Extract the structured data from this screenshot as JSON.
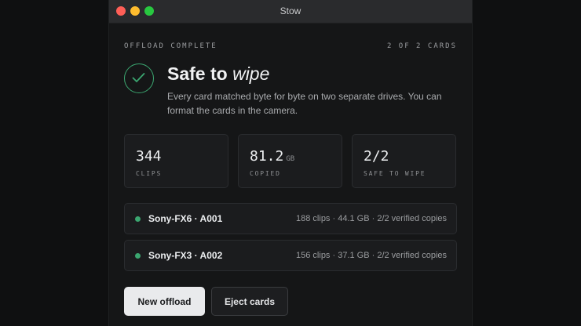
{
  "window": {
    "title": "Stow"
  },
  "header": {
    "eyebrow": "OFFLOAD COMPLETE",
    "progress": "2 OF 2 CARDS",
    "title_main": "Safe to",
    "title_emphasis": "wipe",
    "description": "Every card matched byte for byte on two separate drives. You can format the cards in the camera.",
    "status_icon": "check-icon"
  },
  "stats": [
    {
      "value": "344",
      "unit": "",
      "label": "CLIPS"
    },
    {
      "value": "81.2",
      "unit": "GB",
      "label": "COPIED"
    },
    {
      "value": "2/2",
      "unit": "",
      "label": "SAFE TO WIPE"
    }
  ],
  "cards": [
    {
      "name": "Sony-FX6 · A001",
      "meta": "188 clips · 44.1 GB · 2/2 verified copies"
    },
    {
      "name": "Sony-FX3 · A002",
      "meta": "156 clips · 37.1 GB · 2/2 verified copies"
    }
  ],
  "actions": {
    "primary": "New offload",
    "secondary": "Eject cards"
  },
  "colors": {
    "accent": "#3ba670",
    "background": "#151617",
    "surface": "#1b1c1e"
  }
}
